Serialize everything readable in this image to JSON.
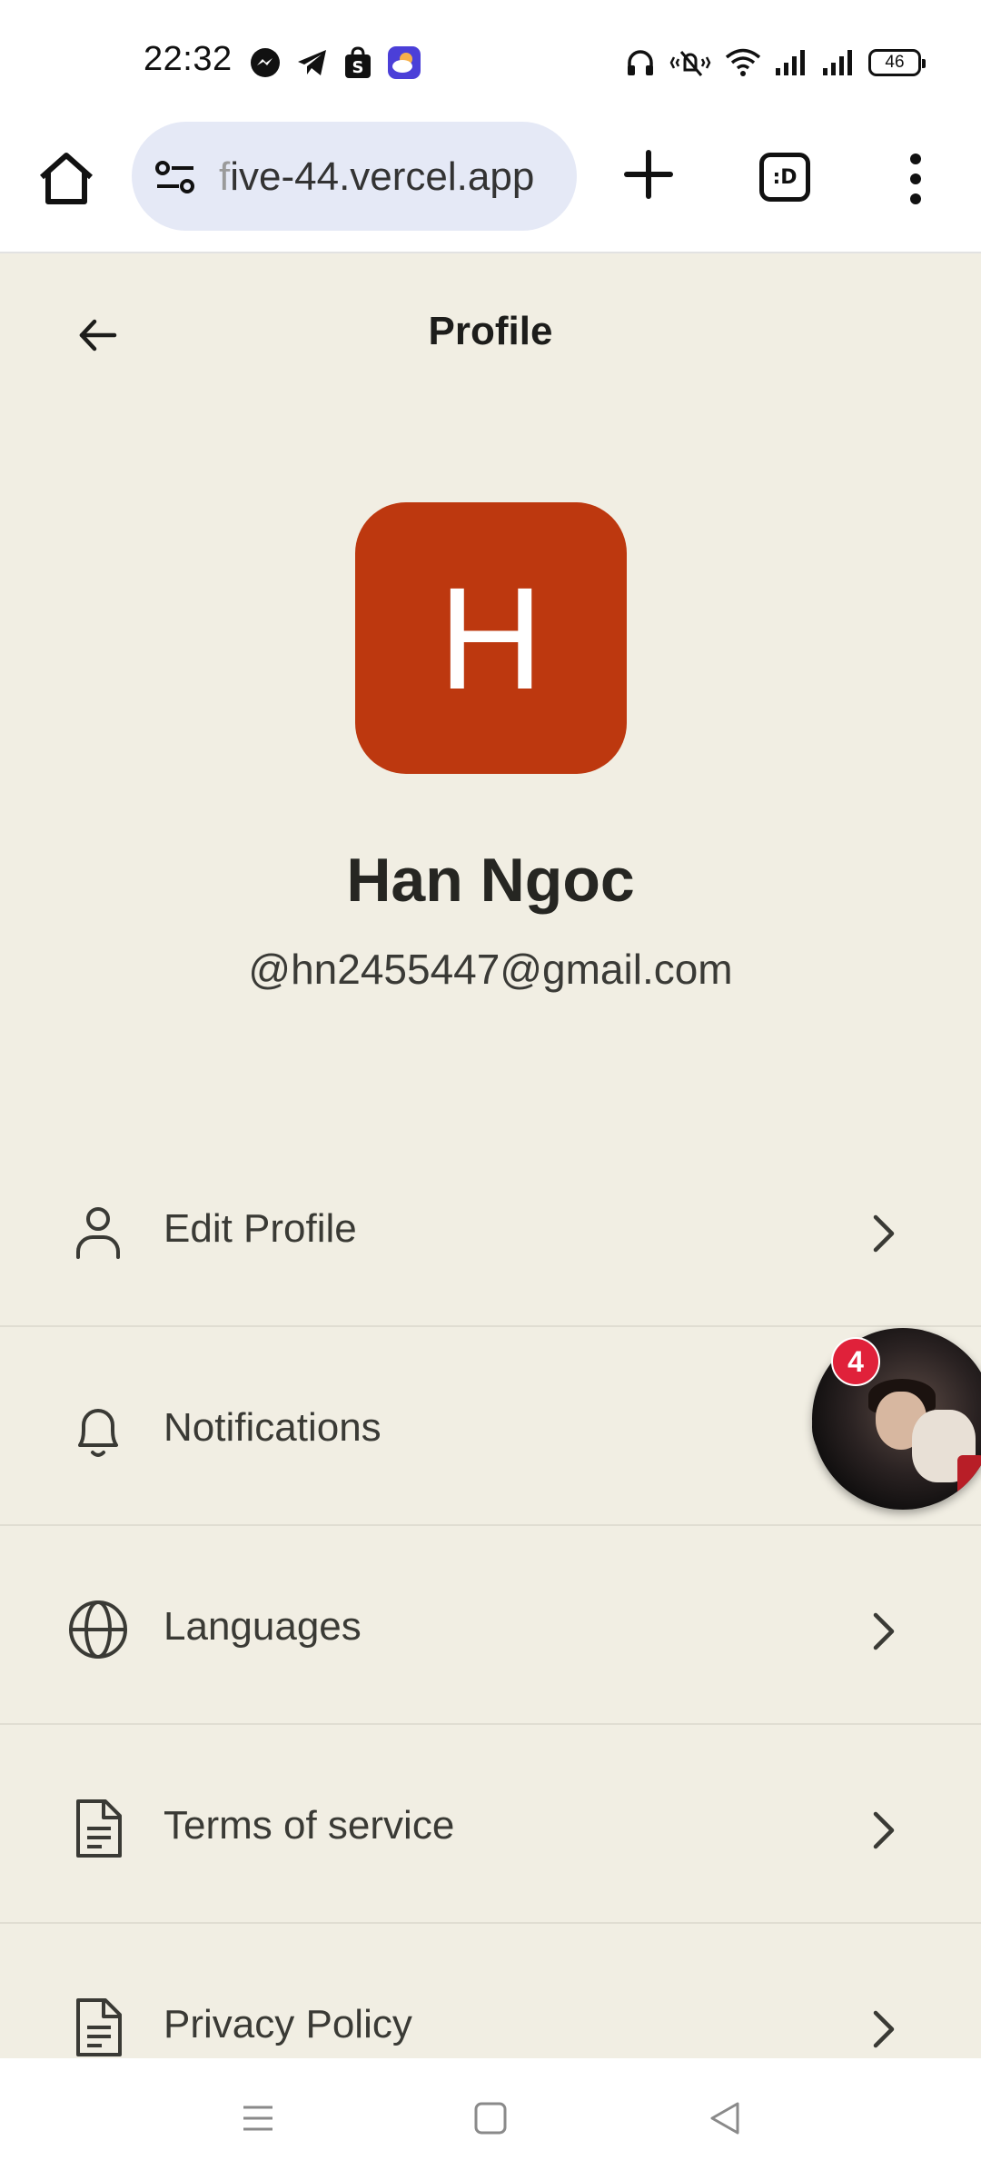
{
  "status_bar": {
    "time": "22:32",
    "battery": "46",
    "left_icons": [
      "messenger-icon",
      "telegram-icon",
      "shopee-icon",
      "weather-app-icon"
    ],
    "right_icons": [
      "headphones-icon",
      "mute-vibrate-icon",
      "wifi-icon",
      "signal-icon",
      "signal-icon"
    ]
  },
  "browser": {
    "url_faded": "f",
    "url": "ive-44.vercel.app",
    "tabs_label": ":D"
  },
  "header": {
    "title": "Profile"
  },
  "profile": {
    "avatar_letter": "H",
    "avatar_color": "#bd380f",
    "name": "Han Ngoc",
    "handle": "@hn2455447@gmail.com"
  },
  "menu": {
    "items": [
      {
        "label": "Edit Profile",
        "icon": "user-icon"
      },
      {
        "label": "Notifications",
        "icon": "bell-icon"
      },
      {
        "label": "Languages",
        "icon": "globe-icon"
      },
      {
        "label": "Terms of service",
        "icon": "document-icon"
      },
      {
        "label": "Privacy Policy",
        "icon": "document-icon"
      }
    ]
  },
  "chat_head": {
    "badge": "4"
  },
  "colors": {
    "background": "#f1eee3",
    "badge": "#e0213a"
  }
}
